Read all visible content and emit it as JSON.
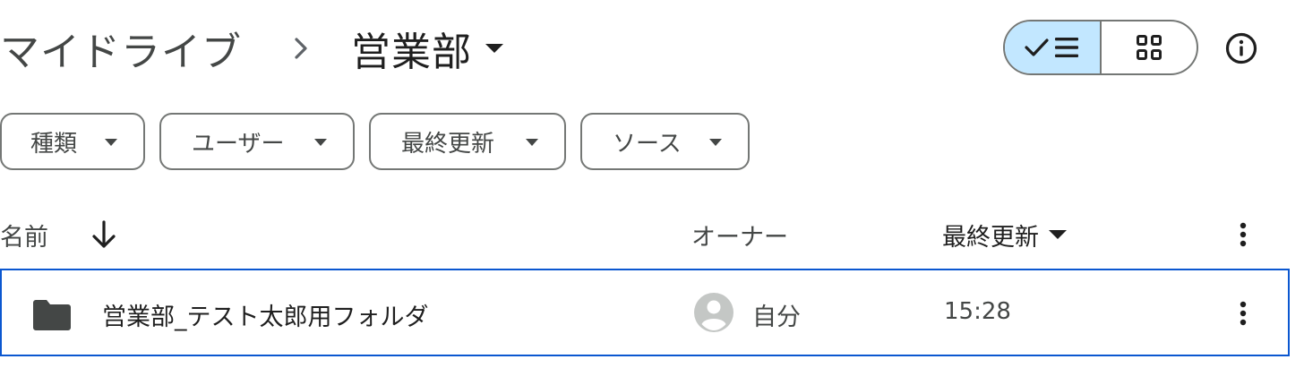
{
  "breadcrumb": {
    "root": "マイドライブ",
    "current": "営業部"
  },
  "view_toggle": {
    "selected": "list"
  },
  "filters": [
    {
      "label": "種類"
    },
    {
      "label": "ユーザー"
    },
    {
      "label": "最終更新"
    },
    {
      "label": "ソース"
    }
  ],
  "table": {
    "headers": {
      "name": "名前",
      "owner": "オーナー",
      "modified": "最終更新"
    },
    "sort": {
      "column": "name",
      "direction": "descending"
    },
    "rows": [
      {
        "name": "営業部_テスト太郎用フォルダ",
        "owner": "自分",
        "modified": "15:28",
        "type": "folder",
        "selected": true
      }
    ]
  },
  "colors": {
    "selected_segment_bg": "#c2e7ff",
    "row_selection_border": "#0b57d0",
    "text_primary": "#1f1f1f",
    "text_secondary": "#444746",
    "outline": "#747775"
  },
  "icons": [
    "chevron-right-icon",
    "dropdown-caret-icon",
    "check-icon",
    "list-view-icon",
    "grid-view-icon",
    "info-icon",
    "arrow-down-icon",
    "more-vert-icon",
    "folder-icon",
    "account-circle-icon"
  ]
}
